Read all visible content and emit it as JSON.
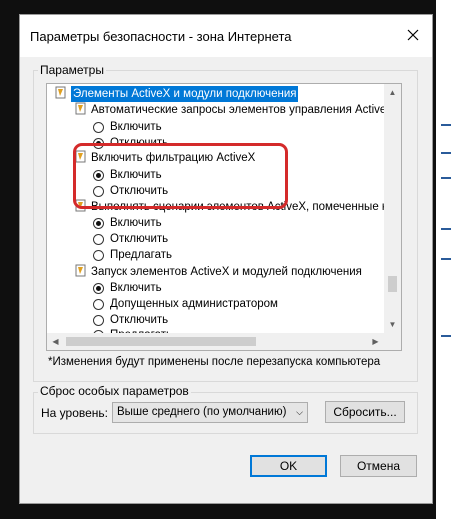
{
  "dialog": {
    "title": "Параметры безопасности - зона Интернета",
    "settings_group_label": "Параметры",
    "note": "*Изменения будут применены после перезапуска компьютера",
    "reset_group_label": "Сброс особых параметров",
    "reset_level_label": "На уровень:",
    "reset_level_value": "Выше среднего (по умолчанию)",
    "reset_button": "Сбросить...",
    "ok_button": "OK",
    "cancel_button": "Отмена"
  },
  "tree": {
    "root": "Элементы ActiveX и модули подключения",
    "cat1": "Автоматические запросы элементов управления ActiveX",
    "cat1_opt1": "Включить",
    "cat1_opt2": "Отключить",
    "cat2": "Включить фильтрацию ActiveX",
    "cat2_opt1": "Включить",
    "cat2_opt2": "Отключить",
    "cat3": "Выполнять сценарии элементов ActiveX, помеченные как",
    "cat3_opt1": "Включить",
    "cat3_opt2": "Отключить",
    "cat3_opt3": "Предлагать",
    "cat4": "Запуск элементов ActiveX и модулей подключения",
    "cat4_opt1": "Включить",
    "cat4_opt2": "Допущенных администратором",
    "cat4_opt3": "Отключить",
    "cat4_opt4": "Предлагать"
  },
  "colors": {
    "selection": "#0078d7",
    "highlight_box": "#d42a2a"
  },
  "icons": [
    "close-icon",
    "activex-category-icon",
    "radio-button",
    "scroll-arrow-icon",
    "chevron-down-icon"
  ]
}
